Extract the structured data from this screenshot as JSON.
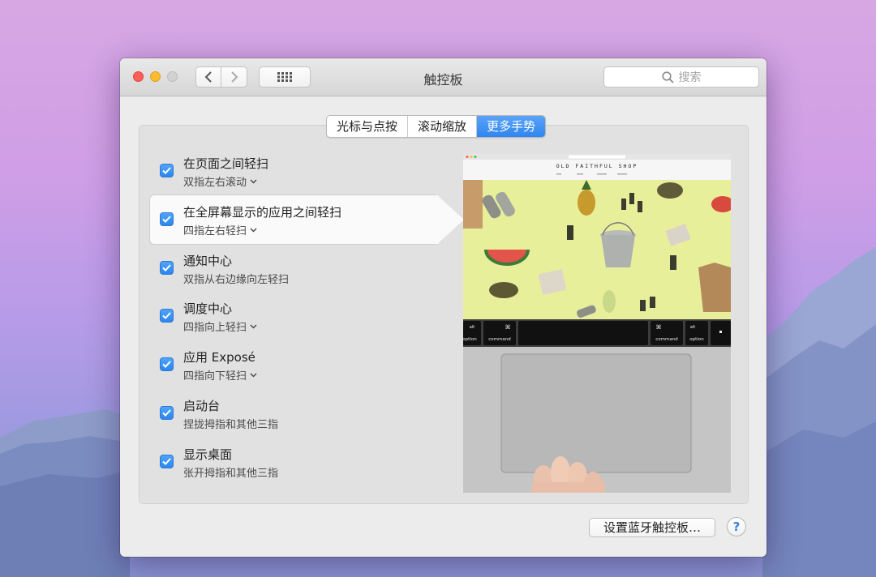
{
  "window": {
    "title": "触控板"
  },
  "search": {
    "placeholder": "搜索"
  },
  "tabs": [
    {
      "label": "光标与点按",
      "active": false
    },
    {
      "label": "滚动缩放",
      "active": false
    },
    {
      "label": "更多手势",
      "active": true
    }
  ],
  "gestures": [
    {
      "title": "在页面之间轻扫",
      "subtitle": "双指左右滚动",
      "checked": true,
      "has_dropdown": true,
      "selected": false
    },
    {
      "title": "在全屏幕显示的应用之间轻扫",
      "subtitle": "四指左右轻扫",
      "checked": true,
      "has_dropdown": true,
      "selected": true
    },
    {
      "title": "通知中心",
      "subtitle": "双指从右边缘向左轻扫",
      "checked": true,
      "has_dropdown": false,
      "selected": false
    },
    {
      "title": "调度中心",
      "subtitle": "四指向上轻扫",
      "checked": true,
      "has_dropdown": true,
      "selected": false
    },
    {
      "title": "应用 Exposé",
      "subtitle": "四指向下轻扫",
      "checked": true,
      "has_dropdown": true,
      "selected": false
    },
    {
      "title": "启动台",
      "subtitle": "捏拢拇指和其他三指",
      "checked": true,
      "has_dropdown": false,
      "selected": false
    },
    {
      "title": "显示桌面",
      "subtitle": "张开拇指和其他三指",
      "checked": true,
      "has_dropdown": false,
      "selected": false
    }
  ],
  "preview": {
    "shop_name": "OLD FAITHFUL SHOP",
    "keys": [
      {
        "symbol": "alt",
        "label": "option"
      },
      {
        "symbol": "⌘",
        "label": "command"
      },
      {
        "symbol": "⌘",
        "label": "command"
      },
      {
        "symbol": "alt",
        "label": "option"
      }
    ]
  },
  "buttons": {
    "bluetooth_setup": "设置蓝牙触控板…",
    "help": "?"
  },
  "colors": {
    "accent": "#2f86ef",
    "close": "#fc5f57",
    "minimize": "#fdbc2e",
    "zoom": "#d2d2d2"
  }
}
